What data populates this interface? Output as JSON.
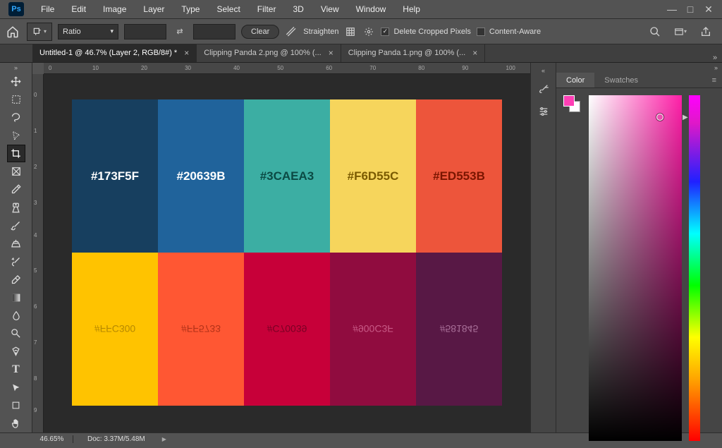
{
  "menu": [
    "File",
    "Edit",
    "Image",
    "Layer",
    "Type",
    "Select",
    "Filter",
    "3D",
    "View",
    "Window",
    "Help"
  ],
  "options": {
    "ratio_label": "Ratio",
    "clear_label": "Clear",
    "straighten_label": "Straighten",
    "delete_label": "Delete Cropped Pixels",
    "content_aware_label": "Content-Aware",
    "delete_checked": true,
    "content_aware_checked": false
  },
  "tabs": [
    {
      "label": "Untitled-1 @ 46.7% (Layer 2, RGB/8#) *",
      "active": true
    },
    {
      "label": "Clipping Panda 2.png @ 100% (...",
      "active": false
    },
    {
      "label": "Clipping Panda 1.png @ 100% (...",
      "active": false
    }
  ],
  "ruler_h": [
    0,
    10,
    20,
    30,
    40,
    50,
    60,
    70,
    80,
    90,
    100
  ],
  "ruler_v": [
    0,
    1,
    2,
    3,
    4,
    5,
    6,
    7,
    8,
    9
  ],
  "palette": {
    "row1": [
      {
        "hex": "#173F5F",
        "label": "#173F5F",
        "fg": "#ffffff"
      },
      {
        "hex": "#20639B",
        "label": "#20639B",
        "fg": "#ffffff"
      },
      {
        "hex": "#3CAEA3",
        "label": "#3CAEA3",
        "fg": "#0b4a44"
      },
      {
        "hex": "#F6D55C",
        "label": "#F6D55C",
        "fg": "#7a5a00"
      },
      {
        "hex": "#ED553B",
        "label": "#ED553B",
        "fg": "#7a1500"
      }
    ],
    "row2": [
      {
        "hex": "#FFC300",
        "label": "#FFC300",
        "fg": "#b78900"
      },
      {
        "hex": "#FF5733",
        "label": "#FF5733",
        "fg": "#b23218"
      },
      {
        "hex": "#C70039",
        "label": "#C70039",
        "fg": "#7a0024"
      },
      {
        "hex": "#900C3F",
        "label": "#900C3F",
        "fg": "#c85a86"
      },
      {
        "hex": "#581845",
        "label": "#581845",
        "fg": "#a86f98"
      }
    ]
  },
  "panel": {
    "tab_color": "Color",
    "tab_swatches": "Swatches"
  },
  "status": {
    "zoom": "46.65%",
    "doc": "Doc: 3.37M/5.48M"
  }
}
